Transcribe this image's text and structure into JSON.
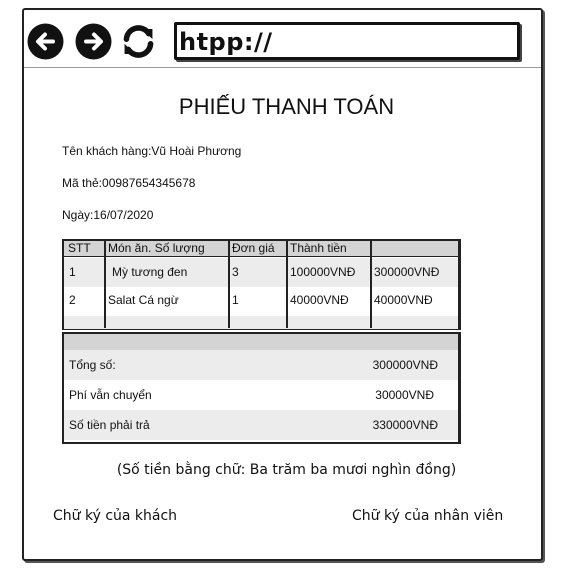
{
  "browser": {
    "url": "htpp://",
    "icons": [
      "arrow-left-circle",
      "arrow-right-circle",
      "reload"
    ]
  },
  "invoice": {
    "title": "PHIẾU THANH TOÁN",
    "customer_line": "Tên khách hàng:Vũ Hoài Phương",
    "card_line": "Mã thẻ:00987654345678",
    "date_line": "Ngày:16/07/2020",
    "table": {
      "headers": [
        "STT",
        "Món ăn. Số lượng",
        "Đơn giá",
        "Thành tiền",
        ""
      ],
      "rows": [
        [
          "1",
          "Mỳ tương đen",
          "3",
          "100000VNĐ",
          "300000VNĐ"
        ],
        [
          "2",
          "Salat Cá ngừ",
          "1",
          "40000VNĐ",
          "40000VNĐ"
        ]
      ]
    },
    "summary": {
      "total_label": "Tổng số:",
      "total_value": "300000VNĐ",
      "shipping_label": "Phí vẫn chuyển",
      "shipping_value": "30000VNĐ",
      "payable_label": "Số tiền phải trả",
      "payable_value": "330000VNĐ"
    },
    "amount_in_words": "(Số tiền bằng chữ: Ba trăm ba mươi nghìn đồng)",
    "signature_customer": "Chữ ký của khách",
    "signature_staff": "Chữ ký của nhân viên"
  }
}
